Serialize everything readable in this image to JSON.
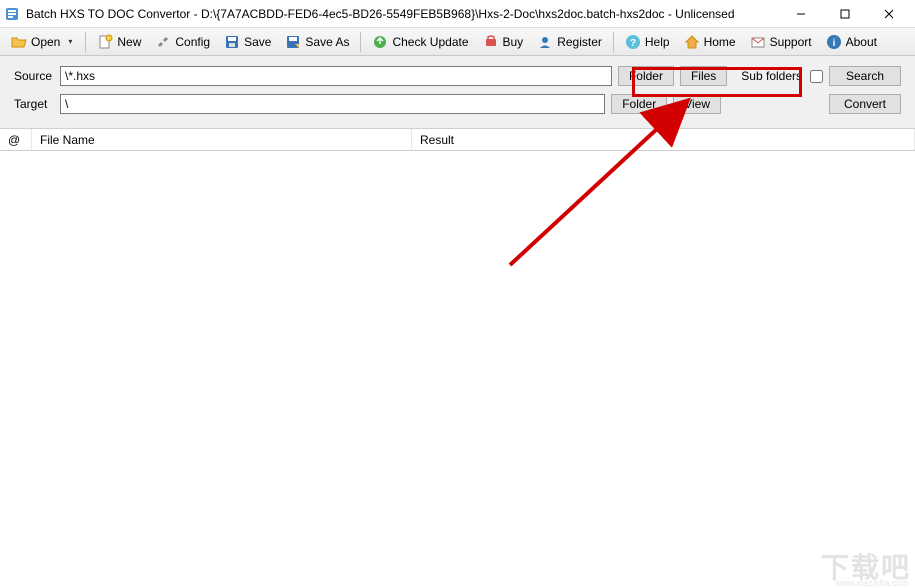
{
  "window": {
    "title": "Batch HXS TO DOC Convertor - D:\\{7A7ACBDD-FED6-4ec5-BD26-5549FEB5B968}\\Hxs-2-Doc\\hxs2doc.batch-hxs2doc - Unlicensed"
  },
  "toolbar": {
    "open": "Open",
    "new": "New",
    "config": "Config",
    "save": "Save",
    "saveAs": "Save As",
    "checkUpdate": "Check Update",
    "buy": "Buy",
    "register": "Register",
    "help": "Help",
    "home": "Home",
    "support": "Support",
    "about": "About"
  },
  "form": {
    "sourceLabel": "Source",
    "sourceValue": "\\*.hxs",
    "targetLabel": "Target",
    "targetValue": "\\",
    "folderBtn": "Folder",
    "filesBtn": "Files",
    "viewBtn": "View",
    "subFoldersLabel": "Sub folders",
    "searchBtn": "Search",
    "convertBtn": "Convert"
  },
  "table": {
    "colAt": "@",
    "colFileName": "File Name",
    "colResult": "Result"
  },
  "watermark": {
    "main": "下载吧",
    "sub": "www.xiazaiba.com"
  }
}
